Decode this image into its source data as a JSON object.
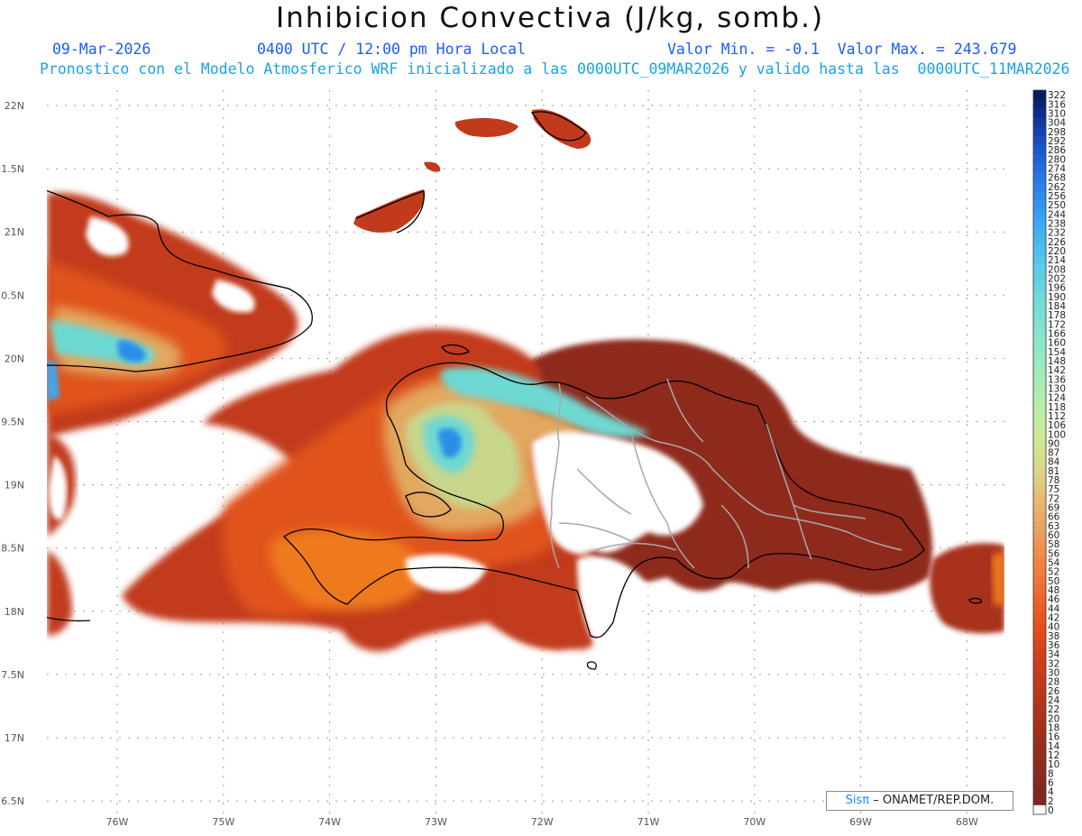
{
  "header": {
    "title": "Inhibicion Convectiva (J/kg, somb.)",
    "date": "09-Mar-2026",
    "time": "0400 UTC / 12:00 pm Hora Local",
    "min_max": "Valor Min. = -0.1  Valor Max. = 243.679",
    "subtitle": "Pronostico con el Modelo Atmosferico WRF inicializado a las 0000UTC_09MAR2026 y valido hasta las  0000UTC_11MAR2026"
  },
  "map": {
    "lat_labels": [
      "22N",
      "1.5N",
      "21N",
      "0.5N",
      "20N",
      "9.5N",
      "19N",
      "8.5N",
      "18N",
      "7.5N",
      "17N",
      "6.5N"
    ],
    "lon_labels": [
      "76W",
      "75W",
      "74W",
      "73W",
      "72W",
      "71W",
      "70W",
      "69W",
      "68W"
    ],
    "colors": {
      "dark_red": "#8e2a1f",
      "red": "#b8361e",
      "orange_red": "#e0521a",
      "orange": "#ef7a1e",
      "tan": "#e2a860",
      "yellow_green": "#c8d68c",
      "cyan": "#6ed8d2",
      "blue": "#2a8ee8",
      "coast": "#000000",
      "border": "#a8a8a8"
    }
  },
  "colorbar": {
    "labels": [
      "322",
      "316",
      "310",
      "304",
      "298",
      "292",
      "286",
      "280",
      "274",
      "268",
      "262",
      "256",
      "250",
      "244",
      "238",
      "232",
      "226",
      "220",
      "214",
      "208",
      "202",
      "196",
      "190",
      "184",
      "178",
      "172",
      "166",
      "160",
      "154",
      "148",
      "142",
      "136",
      "130",
      "124",
      "118",
      "112",
      "106",
      "100",
      "90",
      "87",
      "84",
      "81",
      "78",
      "75",
      "72",
      "69",
      "66",
      "63",
      "60",
      "58",
      "56",
      "54",
      "52",
      "50",
      "48",
      "46",
      "44",
      "42",
      "40",
      "38",
      "36",
      "34",
      "32",
      "30",
      "28",
      "26",
      "24",
      "22",
      "20",
      "18",
      "16",
      "14",
      "12",
      "10",
      "8",
      "6",
      "4",
      "2",
      "0"
    ],
    "colors": [
      "#0a1a5c",
      "#0c2272",
      "#0f2c88",
      "#12389c",
      "#1542b0",
      "#184cc0",
      "#1b57cc",
      "#1e62d6",
      "#226cde",
      "#2676e4",
      "#2a80ea",
      "#2e8aee",
      "#3294f0",
      "#379ef2",
      "#3ca8f2",
      "#42b0f0",
      "#48b8ee",
      "#4ec0ec",
      "#55c6ea",
      "#5ccce8",
      "#62d0e4",
      "#68d4e0",
      "#6ed8dc",
      "#74dcd8",
      "#7ae0d4",
      "#80e2d0",
      "#86e4cc",
      "#8ce6c8",
      "#92e8c4",
      "#98eac0",
      "#9eeabc",
      "#a4ecb8",
      "#aaecb4",
      "#b0eeb0",
      "#b8eeaa",
      "#c0eea4",
      "#c6ec9e",
      "#ccea98",
      "#d0e694",
      "#d4e290",
      "#d8dc8c",
      "#dcd488",
      "#e0cc82",
      "#e2c47c",
      "#e4bc76",
      "#e6b470",
      "#e8ac68",
      "#eaa462",
      "#ec9c5a",
      "#ee9454",
      "#f08c4c",
      "#f08446",
      "#f07c40",
      "#f0743a",
      "#ee6c34",
      "#ec642e",
      "#ea5c28",
      "#e85424",
      "#e44e20",
      "#e0481e",
      "#da441c",
      "#d4401c",
      "#ce3e1c",
      "#c83c1c",
      "#c23a1c",
      "#bc381c",
      "#b6361c",
      "#b0341c",
      "#aa321c",
      "#a4301c",
      "#9e2e1c",
      "#982e1c",
      "#922c1c",
      "#8c2c1e",
      "#882a1e",
      "#842a1e",
      "#80281e",
      "#7c281e",
      "#ffffff"
    ]
  },
  "credit": {
    "sis": "Sisπ",
    "org": "– ONAMET/REP.DOM."
  }
}
